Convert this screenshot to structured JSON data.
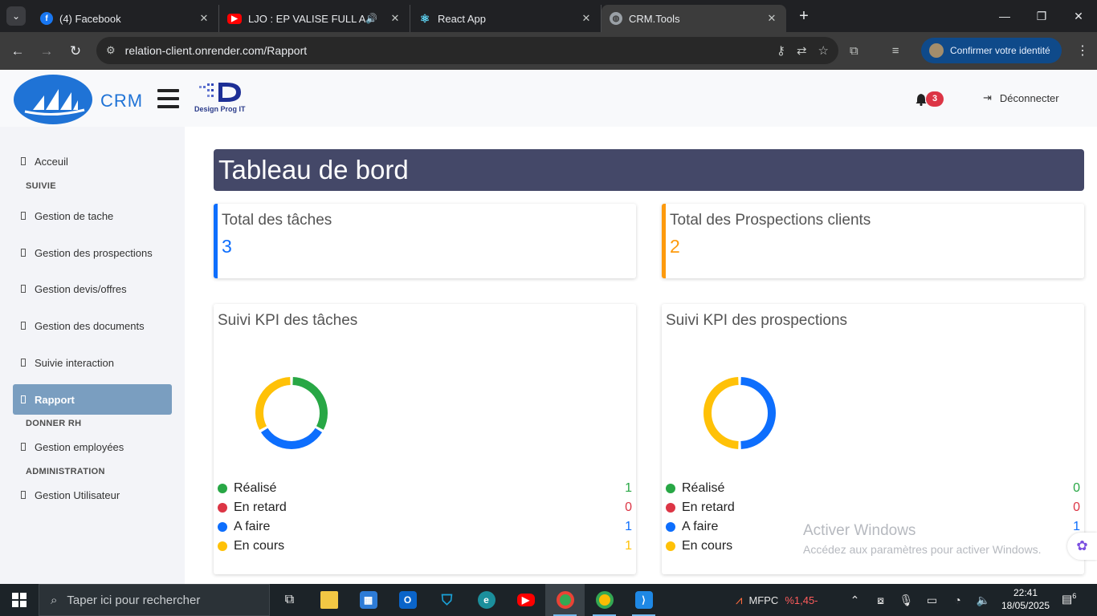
{
  "browser": {
    "tabs": [
      {
        "title": "(4) Facebook",
        "icon": "facebook-icon",
        "color": "#1877f2"
      },
      {
        "title": "LJO : EP VALISE FULL ALBUM",
        "icon": "youtube-icon",
        "color": "#ff0000"
      },
      {
        "title": "React App",
        "icon": "react-icon",
        "color": "#61dafb"
      },
      {
        "title": "CRM.Tools",
        "icon": "globe-icon",
        "color": "#9aa0a6"
      }
    ],
    "url_host": "relation-client.onrender.com",
    "url_path": "/Rapport",
    "identity_label": "Confirmer votre identité"
  },
  "header": {
    "logo_text": "CRM",
    "partner_logo_text": "Design Prog IT",
    "notification_count": "3",
    "logout_label": "Déconnecter"
  },
  "sidebar": {
    "items": [
      {
        "label": "Acceuil"
      },
      {
        "label": "Gestion de tache"
      },
      {
        "label": "Gestion des prospections"
      },
      {
        "label": "Gestion devis/offres"
      },
      {
        "label": "Gestion des documents"
      },
      {
        "label": "Suivie interaction"
      },
      {
        "label": "Rapport",
        "active": true
      },
      {
        "label": "Gestion employées"
      },
      {
        "label": "Gestion Utilisateur"
      }
    ],
    "sections": [
      "SUIVIE",
      "DONNER RH",
      "ADMINISTRATION"
    ]
  },
  "main": {
    "title": "Tableau de bord",
    "stats": [
      {
        "label": "Total des tâches",
        "value": "3",
        "color": "#0d6efd"
      },
      {
        "label": "Total des Prospections clients",
        "value": "2",
        "color": "#fd9a0d"
      }
    ],
    "kpi_cards": [
      {
        "title": "Suivi KPI des tâches"
      },
      {
        "title": "Suivi KPI des prospections"
      }
    ]
  },
  "chart_data": [
    {
      "type": "pie",
      "title": "Suivi KPI des tâches",
      "categories": [
        "Réalisé",
        "En retard",
        "A faire",
        "En cours"
      ],
      "values": [
        1,
        0,
        1,
        1
      ],
      "colors": [
        "#28a745",
        "#dc3545",
        "#0d6efd",
        "#ffc107"
      ]
    },
    {
      "type": "pie",
      "title": "Suivi KPI des prospections",
      "categories": [
        "Réalisé",
        "En retard",
        "A faire",
        "En cours"
      ],
      "values": [
        0,
        0,
        1,
        1
      ],
      "colors": [
        "#28a745",
        "#dc3545",
        "#0d6efd",
        "#ffc107"
      ]
    }
  ],
  "watermark": {
    "line1": "Activer Windows",
    "line2": "Accédez aux paramètres pour activer Windows."
  },
  "taskbar": {
    "search_placeholder": "Taper ici pour rechercher",
    "stock_name": "MFPC",
    "stock_change": "%1,45-",
    "time": "22:41",
    "date": "18/05/2025",
    "notifications": "6"
  }
}
